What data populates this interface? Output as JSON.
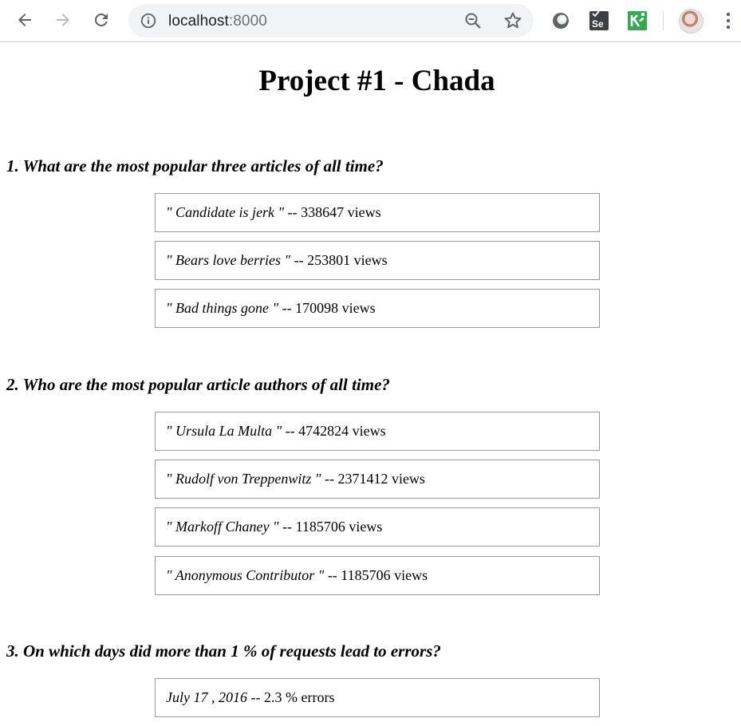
{
  "browser": {
    "url_host": "localhost",
    "url_port": ":8000"
  },
  "page": {
    "title": "Project #1 - Chada",
    "sections": [
      {
        "question": "1. What are the most popular three articles of all time?",
        "answers": [
          {
            "name": "\" Candidate is jerk \"",
            "tail": " -- 338647 views"
          },
          {
            "name": "\" Bears love berries \"",
            "tail": " -- 253801 views"
          },
          {
            "name": "\" Bad things gone \"",
            "tail": " -- 170098 views"
          }
        ]
      },
      {
        "question": "2. Who are the most popular article authors of all time?",
        "answers": [
          {
            "name": "\" Ursula La Multa \"",
            "tail": " -- 4742824 views"
          },
          {
            "name": "\" Rudolf von Treppenwitz \"",
            "tail": " -- 2371412 views"
          },
          {
            "name": "\" Markoff Chaney \"",
            "tail": " -- 1185706 views"
          },
          {
            "name": "\" Anonymous Contributor \"",
            "tail": " -- 1185706 views"
          }
        ]
      },
      {
        "question": "3. On which days did more than 1 % of requests lead to errors?",
        "answers": [
          {
            "name": "July 17 , 2016",
            "tail": " -- 2.3 % errors"
          }
        ]
      }
    ]
  },
  "colors": {
    "chrome_bg": "#ffffff",
    "omnibox_bg": "#f1f3f4",
    "icon_gray": "#5f6368",
    "icon_disabled": "#b9bcbf",
    "answer_border": "#9a9a9a",
    "ext_green": "#34a853"
  }
}
